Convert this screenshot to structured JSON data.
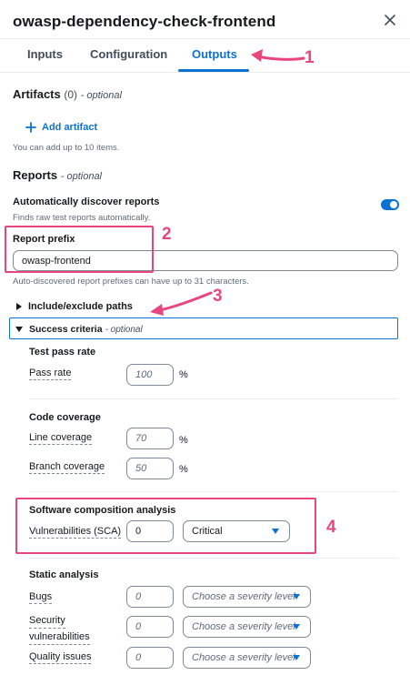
{
  "header": {
    "title": "owasp-dependency-check-frontend"
  },
  "tabs": [
    {
      "label": "Inputs"
    },
    {
      "label": "Configuration"
    },
    {
      "label": "Outputs"
    }
  ],
  "artifacts": {
    "title": "Artifacts",
    "count": "(0)",
    "optional": "- optional",
    "add_label": "Add artifact",
    "hint": "You can add up to 10 items."
  },
  "reports": {
    "title": "Reports",
    "optional": "- optional",
    "auto_discover_title": "Automatically discover reports",
    "auto_discover_desc": "Finds raw test reports automatically.",
    "auto_discover_enabled": true,
    "prefix_label": "Report prefix",
    "prefix_value": "owasp-frontend",
    "prefix_hint": "Auto-discovered report prefixes can have up to 31 characters.",
    "include_exclude_label": "Include/exclude paths",
    "success_criteria_label": "Success criteria",
    "success_criteria_optional": "- optional"
  },
  "test_pass": {
    "title": "Test pass rate",
    "pass_rate_label": "Pass rate",
    "pass_rate_placeholder": "100",
    "unit": "%"
  },
  "coverage": {
    "title": "Code coverage",
    "line_label": "Line coverage",
    "line_placeholder": "70",
    "branch_label": "Branch coverage",
    "branch_placeholder": "50",
    "unit": "%"
  },
  "sca": {
    "title": "Software composition analysis",
    "vuln_label": "Vulnerabilities (SCA)",
    "vuln_value": "0",
    "severity_value": "Critical"
  },
  "static_analysis": {
    "title": "Static analysis",
    "rows": [
      {
        "label": "Bugs",
        "placeholder": "0",
        "severity_placeholder": "Choose a severity level"
      },
      {
        "label": "Security vulnerabilities",
        "label_line1": "Security",
        "label_line2": "vulnerabilities",
        "placeholder": "0",
        "severity_placeholder": "Choose a severity level"
      },
      {
        "label": "Quality issues",
        "placeholder": "0",
        "severity_placeholder": "Choose a severity level"
      }
    ]
  },
  "annotations": [
    "1",
    "2",
    "3",
    "4"
  ],
  "colors": {
    "accent": "#0972d3",
    "annotation": "#e8467c",
    "text": "#16191f"
  }
}
